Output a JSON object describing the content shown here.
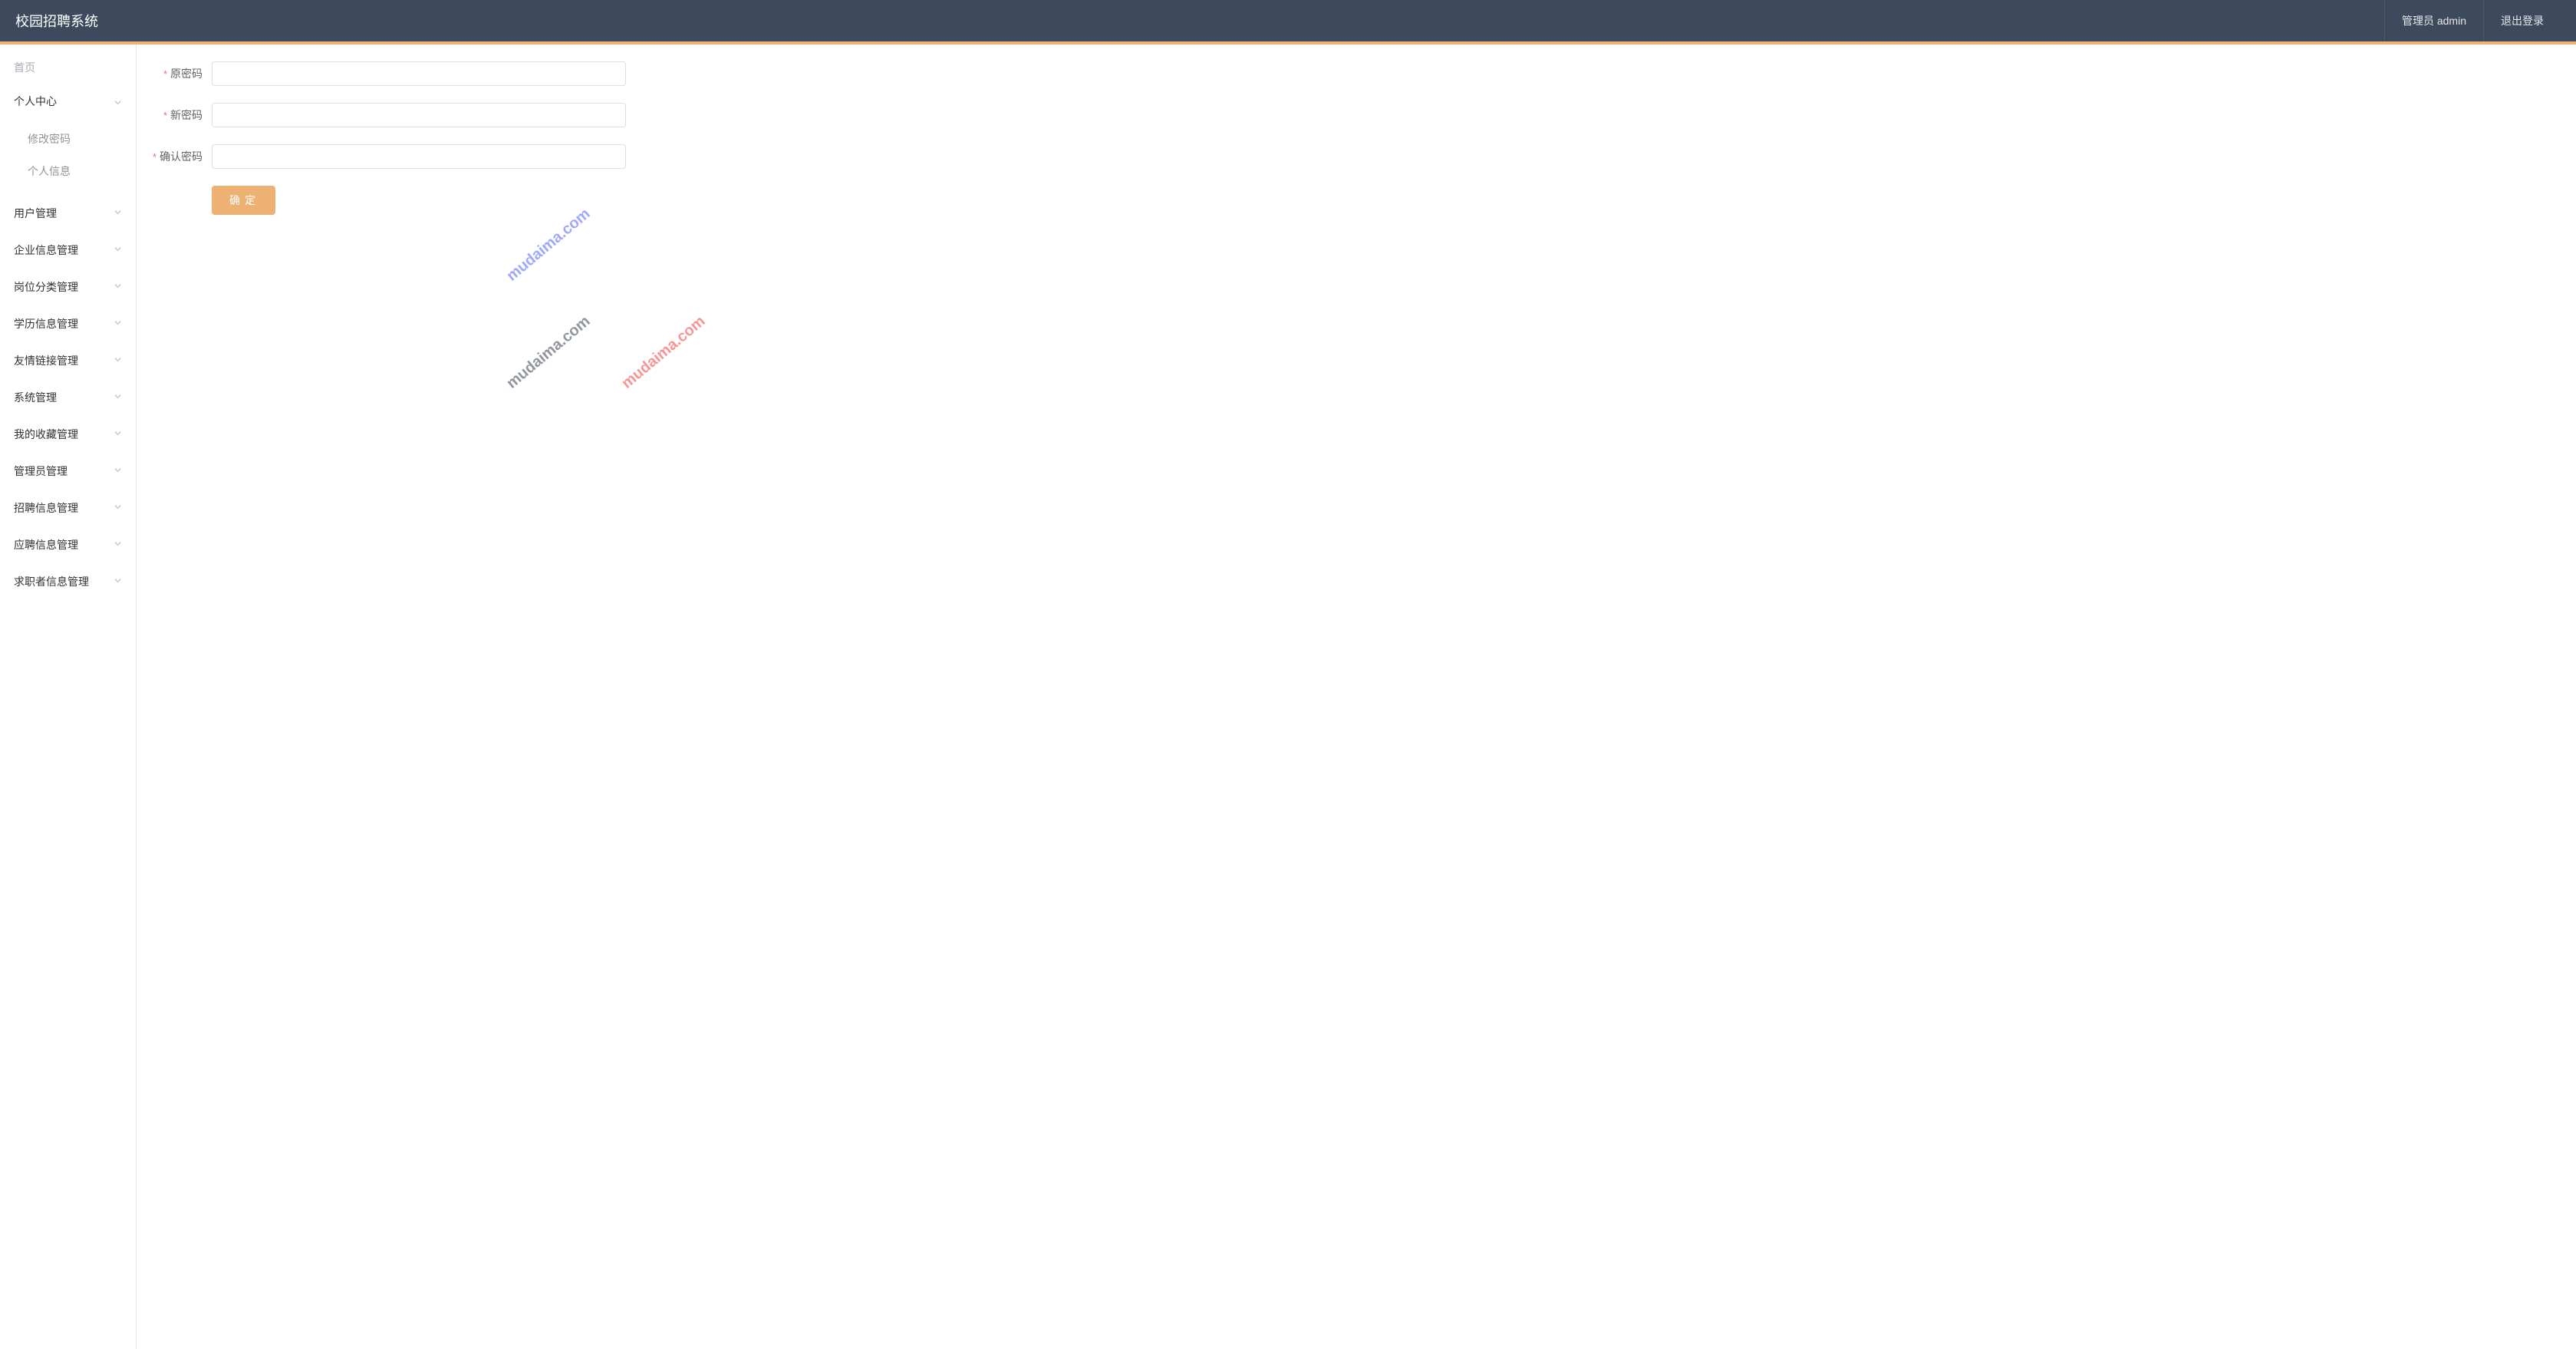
{
  "header": {
    "title": "校园招聘系统",
    "user_label": "管理员 admin",
    "logout_label": "退出登录"
  },
  "sidebar": {
    "home_label": "首页",
    "items": [
      {
        "label": "个人中心",
        "expanded": true,
        "children": [
          {
            "label": "修改密码"
          },
          {
            "label": "个人信息"
          }
        ]
      },
      {
        "label": "用户管理",
        "expanded": false
      },
      {
        "label": "企业信息管理",
        "expanded": false
      },
      {
        "label": "岗位分类管理",
        "expanded": false
      },
      {
        "label": "学历信息管理",
        "expanded": false
      },
      {
        "label": "友情链接管理",
        "expanded": false
      },
      {
        "label": "系统管理",
        "expanded": false
      },
      {
        "label": "我的收藏管理",
        "expanded": false
      },
      {
        "label": "管理员管理",
        "expanded": false
      },
      {
        "label": "招聘信息管理",
        "expanded": false
      },
      {
        "label": "应聘信息管理",
        "expanded": false
      },
      {
        "label": "求职者信息管理",
        "expanded": false
      }
    ]
  },
  "form": {
    "old_password_label": "原密码",
    "new_password_label": "新密码",
    "confirm_password_label": "确认密码",
    "submit_label": "确定",
    "old_password_value": "",
    "new_password_value": "",
    "confirm_password_value": ""
  },
  "watermarks": {
    "text": "mudaima.com"
  }
}
